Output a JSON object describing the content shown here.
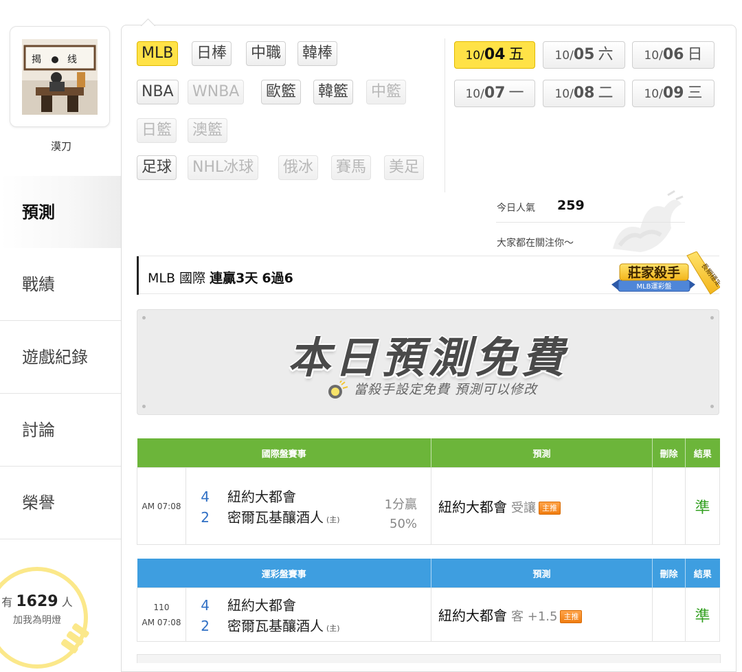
{
  "user": {
    "name": "漠刀"
  },
  "nav": [
    {
      "label": "預測",
      "active": true
    },
    {
      "label": "戰績"
    },
    {
      "label": "遊戲紀錄"
    },
    {
      "label": "討論"
    },
    {
      "label": "榮譽"
    }
  ],
  "fans": {
    "prefix": "有",
    "count": "1629",
    "suffix": "人",
    "cta": "加我為明燈"
  },
  "sports": {
    "row1": [
      {
        "label": "MLB",
        "state": "active"
      },
      {
        "label": "日棒"
      },
      {
        "label": "中職"
      },
      {
        "label": "韓棒"
      }
    ],
    "row2": [
      {
        "label": "NBA"
      },
      {
        "label": "WNBA",
        "state": "disabled"
      },
      {
        "label": "歐籃"
      },
      {
        "label": "韓籃"
      },
      {
        "label": "中籃",
        "state": "disabled"
      }
    ],
    "row3": [
      {
        "label": "日籃",
        "state": "disabled"
      },
      {
        "label": "澳籃",
        "state": "disabled"
      }
    ],
    "row4": [
      {
        "label": "足球"
      },
      {
        "label": "NHL冰球",
        "state": "disabled"
      },
      {
        "label": "俄冰",
        "state": "disabled"
      },
      {
        "label": "賽馬",
        "state": "disabled"
      },
      {
        "label": "美足",
        "state": "disabled"
      }
    ]
  },
  "dates": [
    {
      "month": "10/",
      "day": "04",
      "weekday": "五",
      "active": true
    },
    {
      "month": "10/",
      "day": "05",
      "weekday": "六"
    },
    {
      "month": "10/",
      "day": "06",
      "weekday": "日"
    },
    {
      "month": "10/",
      "day": "07",
      "weekday": "一"
    },
    {
      "month": "10/",
      "day": "08",
      "weekday": "二"
    },
    {
      "month": "10/",
      "day": "09",
      "weekday": "三"
    }
  ],
  "popularity": {
    "label": "今日人氣",
    "value": "259",
    "sub": "大家都在關注你～"
  },
  "record": {
    "league": "MLB 國際",
    "streak": "連贏3天",
    "ratio": "6過6"
  },
  "killer_badge": {
    "title": "莊家殺手",
    "subtitle": "MLB運彩盤",
    "ribbon": "長期穩定"
  },
  "banner": {
    "title": "本日預測免費",
    "subtitle": "當殺手設定免費 預測可以修改"
  },
  "intl_table": {
    "headers": [
      "國際盤賽事",
      "預測",
      "刪除",
      "結果"
    ],
    "rows": [
      {
        "time": "AM 07:08",
        "away_num": "4",
        "away": "紐約大都會",
        "home_num": "2",
        "home": "密爾瓦基釀酒人",
        "home_mark": "(主)",
        "handicap": "1分贏",
        "handicap_pct": "50%",
        "pick": "紐約大都會",
        "pick_extra": "受讓",
        "pick_badge": "主推",
        "result": "準"
      }
    ]
  },
  "lottery_table": {
    "headers": [
      "運彩盤賽事",
      "預測",
      "刪除",
      "結果"
    ],
    "rows": [
      {
        "game_no": "110",
        "time": "AM 07:08",
        "away_num": "4",
        "away": "紐約大都會",
        "home_num": "2",
        "home": "密爾瓦基釀酒人",
        "home_mark": "(主)",
        "pick": "紐約大都會",
        "pick_extra": "客 +1.5",
        "pick_badge": "主推",
        "result": "準"
      }
    ]
  },
  "colors": {
    "accent": "#ffe247",
    "green_header": "#6cb53a",
    "blue_header": "#3e9ee0",
    "hit": "#33a021",
    "badge": "#f07d10"
  }
}
